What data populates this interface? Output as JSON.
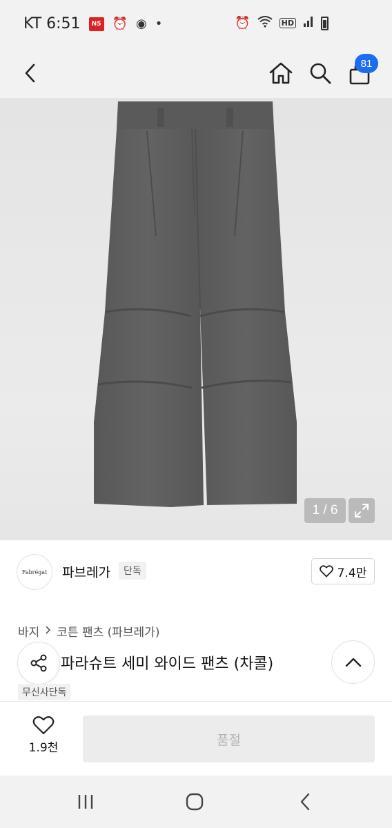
{
  "status_bar": {
    "carrier_time": "KT 6:51",
    "news_badge": "N5",
    "icons": [
      "ns-badge",
      "alarm-icon",
      "app-circle-icon",
      "dot-icon",
      "alarm-clock-icon",
      "wifi-icon",
      "hd-icon",
      "signal-icon",
      "battery-icon"
    ],
    "hd_label": "HD"
  },
  "header": {
    "cart_count": "81",
    "icons": [
      "back-chevron-icon",
      "home-icon",
      "search-icon",
      "shopping-bag-icon"
    ]
  },
  "gallery": {
    "page_indicator": "1 / 6",
    "icons": [
      "expand-icon"
    ]
  },
  "brand": {
    "logo_text": "Fabrégat",
    "name": "파브레가",
    "badge": "단독",
    "like_count": "7.4만"
  },
  "breadcrumb": {
    "category": "바지",
    "subcategory": "코튼 팬츠 (파브레가)"
  },
  "product": {
    "title": "파라슈트 세미 와이드 팬츠 (차콜)",
    "exclusive_tag": "무신사단독"
  },
  "bottom_bar": {
    "wish_count": "1.9천",
    "purchase_label": "품절"
  },
  "colors": {
    "accent": "#1c6df2",
    "pants": "#5c5d5c"
  }
}
